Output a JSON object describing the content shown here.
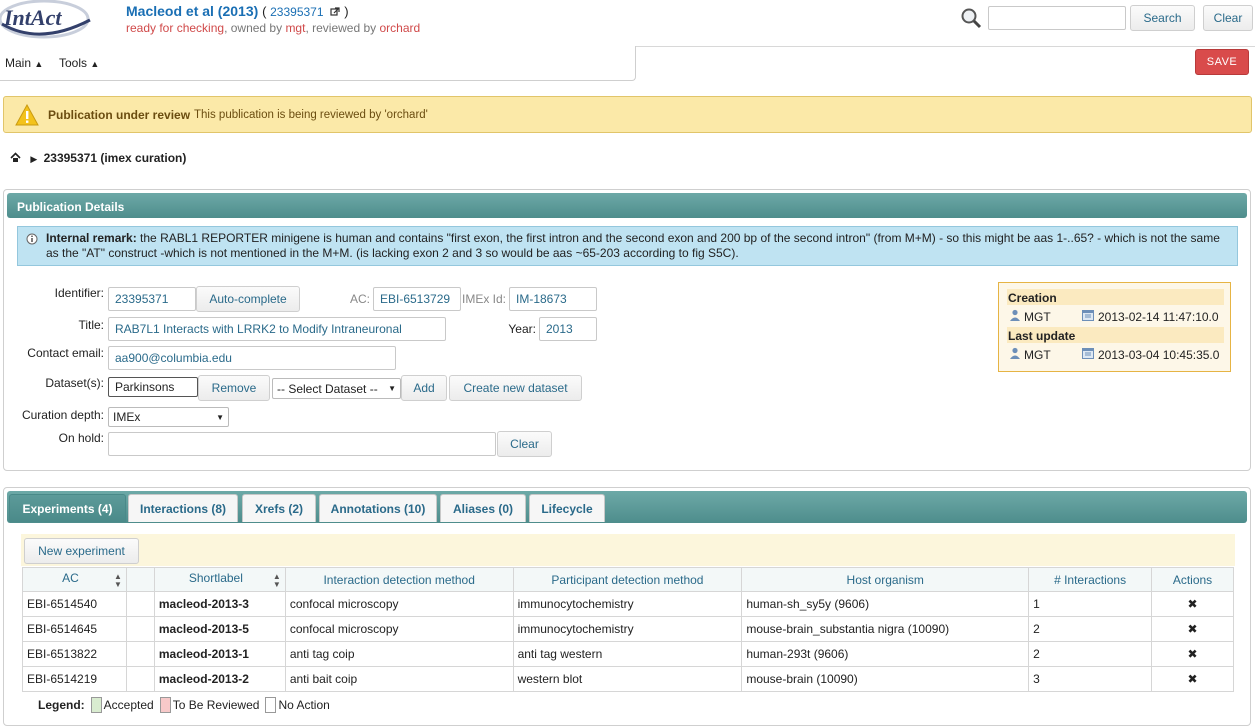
{
  "header": {
    "logo_text": "IntAct",
    "pub_title": "Macleod et al (2013)",
    "pub_pmid": "23395371",
    "status_prefix": "ready for checking",
    "owned_by_label": ", owned by ",
    "owner": "mgt",
    "reviewed_by_label": ", reviewed by ",
    "reviewer": "orchard",
    "search_placeholder": "",
    "search_label": "Search",
    "clear_label": "Clear"
  },
  "menu": {
    "main_label": "Main",
    "tools_label": "Tools",
    "save_label": "SAVE"
  },
  "banner": {
    "title": "Publication under review",
    "message": "This publication is being reviewed by 'orchard'"
  },
  "breadcrumb": {
    "current": "23395371 (imex curation)"
  },
  "details": {
    "panel_title": "Publication Details",
    "remark_label": "Internal remark:",
    "remark_text": "the RABL1 REPORTER minigene is human and contains \"first exon, the first intron and the second exon and 200 bp of the second intron\" (from M+M) - so this might be aas 1-..65? - which is not the same as the \"AT\" construct -which is not mentioned in the M+M. (is lacking exon 2 and 3 so would be aas ~65-203 according to fig S5C).",
    "identifier_label": "Identifier:",
    "identifier_value": "23395371",
    "autocomplete_label": "Auto-complete",
    "ac_label": "AC:",
    "ac_value": "EBI-6513729",
    "imex_label": "IMEx Id:",
    "imex_value": "IM-18673",
    "title_label": "Title:",
    "title_value": "RAB7L1 Interacts with LRRK2 to Modify Intraneuronal",
    "year_label": "Year:",
    "year_value": "2013",
    "contact_label": "Contact email:",
    "contact_value": "aa900@columbia.edu",
    "dataset_label": "Dataset(s):",
    "dataset_value": "Parkinsons",
    "remove_label": "Remove",
    "select_dataset": "-- Select Dataset --",
    "add_label": "Add",
    "create_dataset_label": "Create new dataset",
    "curation_label": "Curation depth:",
    "curation_value": "IMEx",
    "onhold_label": "On hold:",
    "onhold_value": "",
    "onhold_clear_label": "Clear",
    "creation_label": "Creation",
    "creation_user": "MGT",
    "creation_date": "2013-02-14 11:47:10.0",
    "update_label": "Last update",
    "update_user": "MGT",
    "update_date": "2013-03-04 10:45:35.0"
  },
  "tabs": [
    {
      "label": "Experiments (4)",
      "active": true
    },
    {
      "label": "Interactions (8)"
    },
    {
      "label": "Xrefs (2)"
    },
    {
      "label": "Annotations (10)"
    },
    {
      "label": "Aliases (0)"
    },
    {
      "label": "Lifecycle"
    }
  ],
  "experiments": {
    "new_label": "New experiment",
    "columns": [
      "AC",
      "",
      "Shortlabel",
      "Interaction detection method",
      "Participant detection method",
      "Host organism",
      "# Interactions",
      "Actions"
    ],
    "rows": [
      {
        "ac": "EBI-6514540",
        "shortlabel": "macleod-2013-3",
        "idm": "confocal microscopy",
        "pdm": "immunocytochemistry",
        "host": "human-sh_sy5y (9606)",
        "count": "1"
      },
      {
        "ac": "EBI-6514645",
        "shortlabel": "macleod-2013-5",
        "idm": "confocal microscopy",
        "pdm": "immunocytochemistry",
        "host": "mouse-brain_substantia nigra (10090)",
        "count": "2"
      },
      {
        "ac": "EBI-6513822",
        "shortlabel": "macleod-2013-1",
        "idm": "anti tag coip",
        "pdm": "anti tag western",
        "host": "human-293t (9606)",
        "count": "2"
      },
      {
        "ac": "EBI-6514219",
        "shortlabel": "macleod-2013-2",
        "idm": "anti bait coip",
        "pdm": "western blot",
        "host": "mouse-brain (10090)",
        "count": "3"
      }
    ],
    "delete_glyph": "✖"
  },
  "legend": {
    "label": "Legend:",
    "accepted": "Accepted",
    "to_review": "To Be Reviewed",
    "no_action": "No Action",
    "colors": {
      "accepted": "#d9ecd0",
      "to_review": "#f7c9c9",
      "no_action": "#ffffff"
    }
  }
}
